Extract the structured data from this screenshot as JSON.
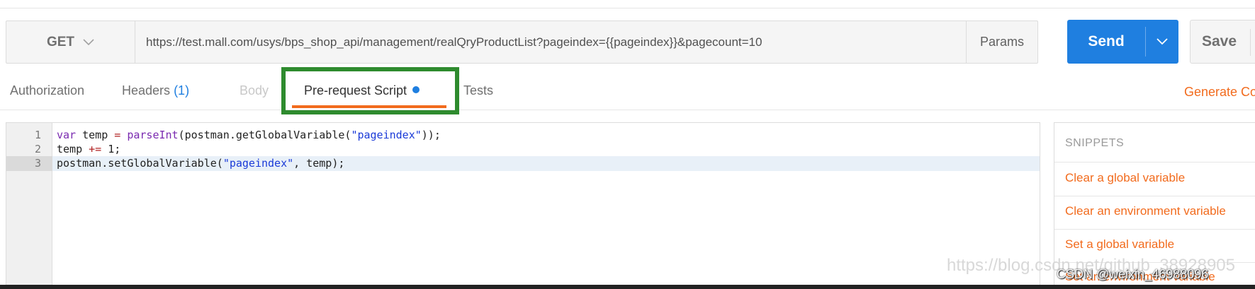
{
  "request": {
    "method": "GET",
    "url": "https://test.mall.com/usys/bps_shop_api/management/realQryProductList?pageindex={{pageindex}}&pagecount=10",
    "params_label": "Params",
    "send_label": "Send",
    "save_label": "Save"
  },
  "tabs": [
    {
      "label": "Authorization"
    },
    {
      "label": "Headers",
      "count": "(1)"
    },
    {
      "label": "Body"
    },
    {
      "label": "Pre-request Script",
      "active": true
    },
    {
      "label": "Tests"
    }
  ],
  "generate_code_label": "Generate Code",
  "editor": {
    "line_numbers": [
      "1",
      "2",
      "3"
    ],
    "lines": [
      "var temp = parseInt(postman.getGlobalVariable(\"pageindex\"));",
      "temp += 1;",
      "postman.setGlobalVariable(\"pageindex\", temp);"
    ],
    "highlighted_line": 3
  },
  "snippets": {
    "header": "SNIPPETS",
    "items": [
      "Clear a global variable",
      "Clear an environment variable",
      "Set a global variable",
      "Set an environment variable"
    ]
  },
  "watermark": "https://blog.csdn.net/github_38928905",
  "credit": "CSDN @weixin_46988096",
  "colors": {
    "accent_orange": "#f26b1d",
    "send_blue": "#1f7fe0",
    "highlight_green": "#2e8b2e"
  }
}
